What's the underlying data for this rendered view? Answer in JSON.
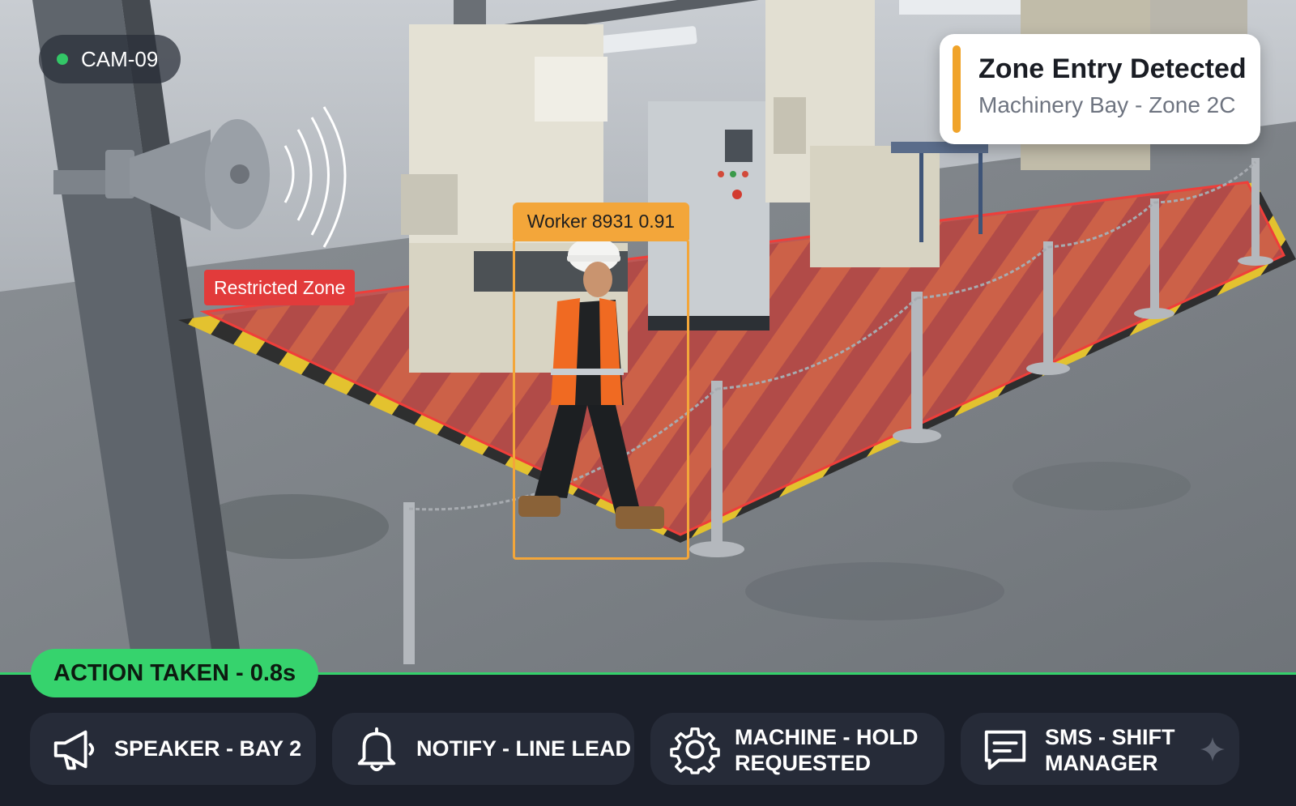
{
  "camera": {
    "id": "CAM-09",
    "status_color": "#33c767"
  },
  "alert": {
    "title": "Zone Entry Detected",
    "subtitle": "Machinery Bay - Zone 2C",
    "accent_color": "#f0a32a"
  },
  "zone": {
    "label": "Restricted Zone",
    "color": "#e23b3b"
  },
  "detection": {
    "label": "Worker 8931 0.91",
    "color": "#f3a63a"
  },
  "action_status": {
    "label": "ACTION TAKEN - 0.8s",
    "color": "#36d36d"
  },
  "actions": [
    {
      "icon": "megaphone-icon",
      "label_line1": "SPEAKER - BAY 2",
      "label_line2": ""
    },
    {
      "icon": "bell-icon",
      "label_line1": "NOTIFY - LINE LEAD",
      "label_line2": ""
    },
    {
      "icon": "gear-icon",
      "label_line1": "MACHINE - HOLD",
      "label_line2": "REQUESTED"
    },
    {
      "icon": "message-icon",
      "label_line1": "SMS - SHIFT",
      "label_line2": "MANAGER"
    }
  ]
}
